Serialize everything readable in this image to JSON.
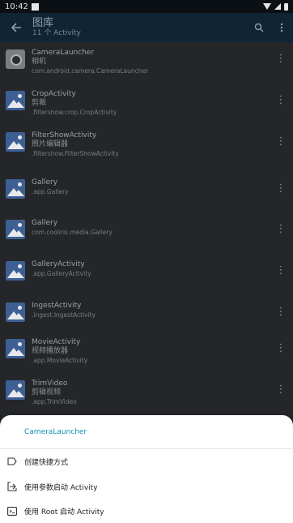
{
  "status_bar": {
    "time": "10:42"
  },
  "app_bar": {
    "title": "图库",
    "subtitle": "11 个 Activity",
    "back_icon": "arrow-left-icon",
    "search_icon": "search-icon",
    "overflow_icon": "more-vert-icon"
  },
  "activities": [
    {
      "name": "CameraLauncher",
      "label": "相机",
      "class": "com.android.camera.CameraLauncher",
      "icon": "camera-icon"
    },
    {
      "name": "CropActivity",
      "label": "剪裁",
      "class": ".filtershow.crop.CropActivity",
      "icon": "image-icon"
    },
    {
      "name": "FilterShowActivity",
      "label": "照片编辑器",
      "class": ".filtershow.FilterShowActivity",
      "icon": "image-icon"
    },
    {
      "name": "Gallery",
      "label": "",
      "class": ".app.Gallery",
      "icon": "image-icon"
    },
    {
      "name": "Gallery",
      "label": "",
      "class": "com.cooliris.media.Gallery",
      "icon": "image-icon"
    },
    {
      "name": "GalleryActivity",
      "label": "",
      "class": ".app.GalleryActivity",
      "icon": "image-icon"
    },
    {
      "name": "IngestActivity",
      "label": "",
      "class": ".ingest.IngestActivity",
      "icon": "image-icon"
    },
    {
      "name": "MovieActivity",
      "label": "视频播放器",
      "class": ".app.MovieActivity",
      "icon": "image-icon"
    },
    {
      "name": "TrimVideo",
      "label": "剪辑视频",
      "class": ".app.TrimVideo",
      "icon": "image-icon"
    }
  ],
  "bottom_sheet": {
    "title": "CameraLauncher",
    "items": [
      {
        "label": "创建快捷方式",
        "icon": "label-icon"
      },
      {
        "label": "使用参数启动 Activity",
        "icon": "launch-icon"
      },
      {
        "label": "使用 Root 启动 Activity",
        "icon": "terminal-icon"
      }
    ]
  }
}
